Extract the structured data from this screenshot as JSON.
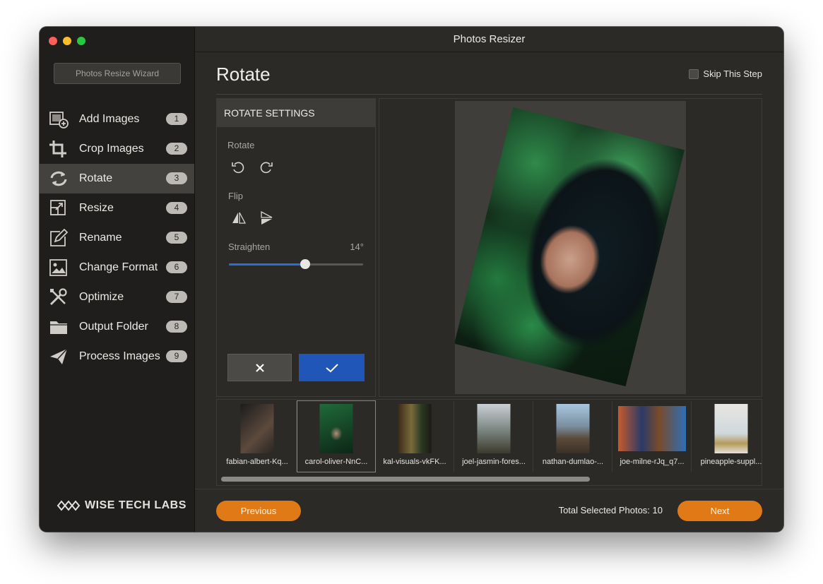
{
  "window": {
    "title": "Photos Resizer",
    "traffic_lights": {
      "close": "#ff5f57",
      "minimize": "#febc2e",
      "zoom": "#28c840"
    }
  },
  "sidebar": {
    "wizard_label": "Photos Resize Wizard",
    "items": [
      {
        "label": "Add Images",
        "badge": "1",
        "icon": "add-images-icon"
      },
      {
        "label": "Crop Images",
        "badge": "2",
        "icon": "crop-icon"
      },
      {
        "label": "Rotate",
        "badge": "3",
        "icon": "rotate-icon",
        "active": true
      },
      {
        "label": "Resize",
        "badge": "4",
        "icon": "resize-icon"
      },
      {
        "label": "Rename",
        "badge": "5",
        "icon": "rename-icon"
      },
      {
        "label": "Change Format",
        "badge": "6",
        "icon": "image-format-icon"
      },
      {
        "label": "Optimize",
        "badge": "7",
        "icon": "tools-icon"
      },
      {
        "label": "Output Folder",
        "badge": "8",
        "icon": "folder-icon"
      },
      {
        "label": "Process Images",
        "badge": "9",
        "icon": "paper-plane-icon"
      }
    ],
    "brand": "WISE TECH LABS"
  },
  "main": {
    "page_title": "Rotate",
    "skip_label": "Skip This Step",
    "settings": {
      "heading": "ROTATE SETTINGS",
      "rotate_label": "Rotate",
      "flip_label": "Flip",
      "straighten_label": "Straighten",
      "straighten_value": "14°",
      "straighten_fraction": 0.57
    },
    "thumbnails": [
      {
        "name": "fabian-albert-Kq..."
      },
      {
        "name": "carol-oliver-NnC...",
        "active": true
      },
      {
        "name": "kal-visuals-vkFK..."
      },
      {
        "name": "joel-jasmin-fores..."
      },
      {
        "name": "nathan-dumlao-..."
      },
      {
        "name": "joe-milne-rJq_q7..."
      },
      {
        "name": "pineapple-suppl..."
      }
    ]
  },
  "footer": {
    "previous_label": "Previous",
    "next_label": "Next",
    "total_label": "Total Selected Photos: 10"
  },
  "colors": {
    "accent_orange": "#e07a17",
    "accent_blue": "#1f56b8",
    "slider_blue": "#2b6fd6"
  }
}
